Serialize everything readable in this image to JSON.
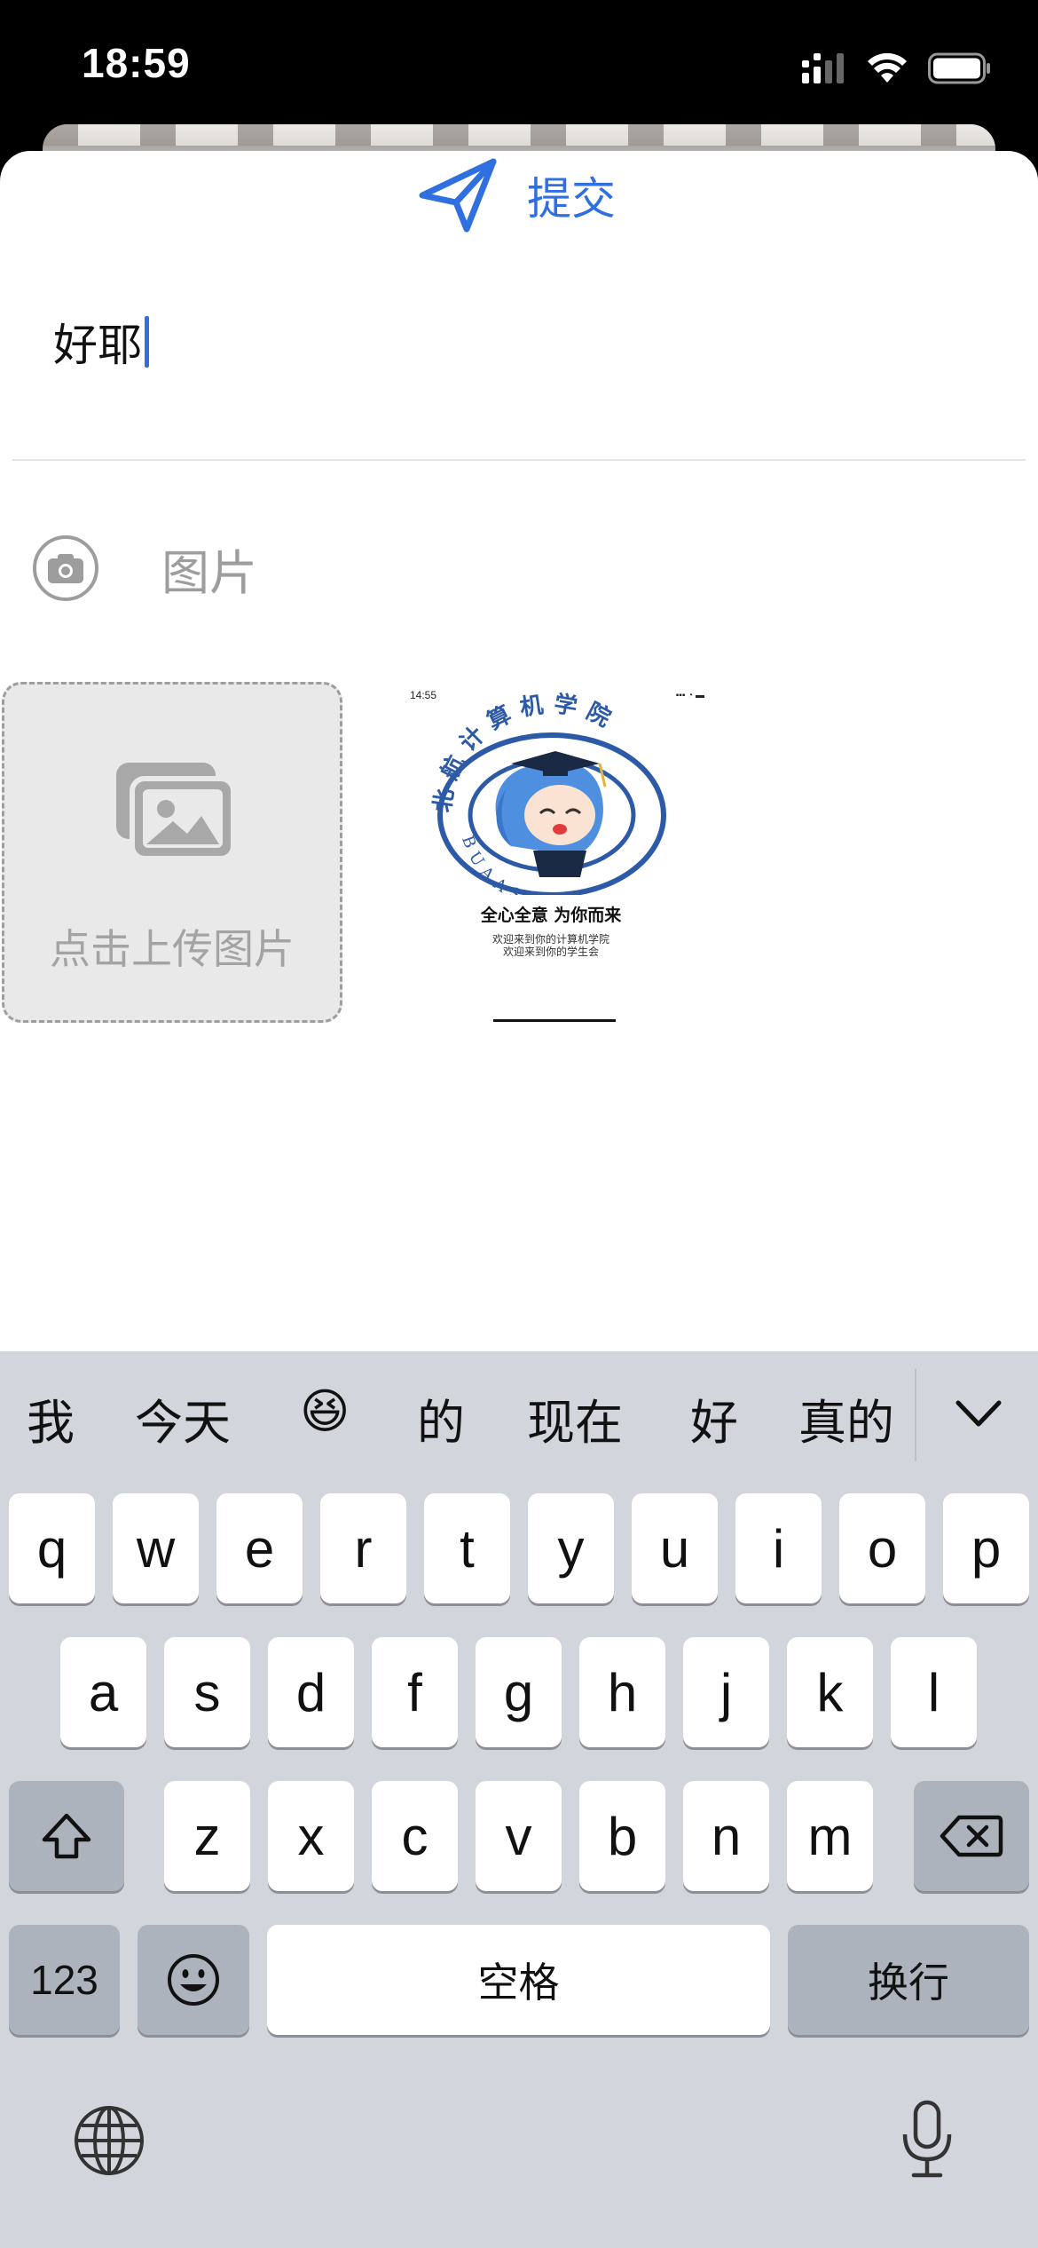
{
  "status_bar": {
    "time": "18:59"
  },
  "sheet": {
    "submit_label": "提交",
    "input_value": "好耶",
    "photo_section_label": "图片",
    "upload_label": "点击上传图片"
  },
  "thumbnail": {
    "status_time": "14:55",
    "badge_top": "北航计算机学院",
    "badge_bottom": "BUAASCSE",
    "slogan": "全心全意 为你而来",
    "subline_1": "欢迎来到你的计算机学院",
    "subline_2": "欢迎来到你的学生会",
    "colors": {
      "badge_blue": "#2d5aa6",
      "character_hair": "#4f8fe0"
    }
  },
  "keyboard": {
    "candidates": [
      "我",
      "今天",
      "😆",
      "的",
      "现在",
      "好",
      "真的"
    ],
    "row1": [
      "q",
      "w",
      "e",
      "r",
      "t",
      "y",
      "u",
      "i",
      "o",
      "p"
    ],
    "row2": [
      "a",
      "s",
      "d",
      "f",
      "g",
      "h",
      "j",
      "k",
      "l"
    ],
    "row3": [
      "z",
      "x",
      "c",
      "v",
      "b",
      "n",
      "m"
    ],
    "numbers_label": "123",
    "space_label": "空格",
    "return_label": "换行"
  },
  "colors": {
    "accent": "#2f6fe0",
    "keyboard_bg": "#d2d5db",
    "function_key": "#adb3bc"
  }
}
